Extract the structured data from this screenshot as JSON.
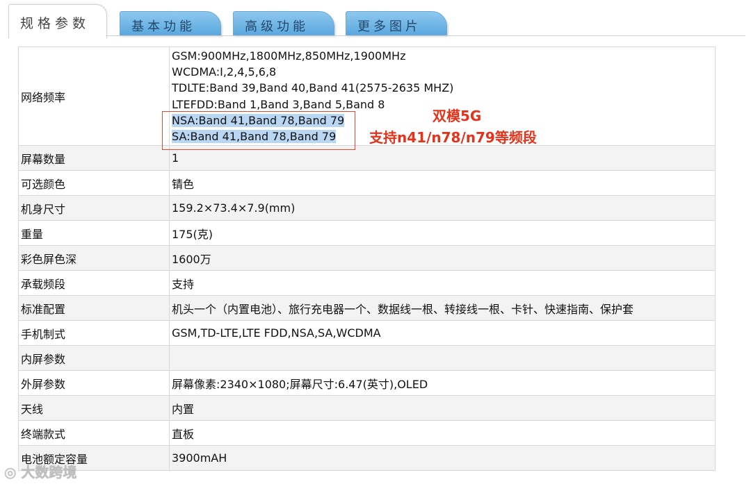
{
  "tabs": {
    "active": "规格参数",
    "others": [
      "基本功能",
      "高级功能",
      "更多图片"
    ]
  },
  "network": {
    "label": "网络频率",
    "lines": [
      "GSM:900MHz,1800MHz,850MHz,1900MHz",
      "WCDMA:I,2,4,5,6,8",
      "TDLTE:Band 39,Band 40,Band 41(2575-2635 MHZ)",
      "LTEFDD:Band 1,Band 3,Band 5,Band 8",
      "NSA:Band 41,Band 78,Band 79",
      "SA:Band 41,Band 78,Band 79"
    ]
  },
  "annotation": {
    "line1": "双模5G",
    "line2": "支持n41/n78/n79等频段"
  },
  "rows": [
    {
      "label": "屏幕数量",
      "value": "1"
    },
    {
      "label": "可选颜色",
      "value": "锖色"
    },
    {
      "label": "机身尺寸",
      "value": "159.2×73.4×7.9(mm)"
    },
    {
      "label": "重量",
      "value": "175(克)"
    },
    {
      "label": "彩色屏色深",
      "value": "1600万"
    },
    {
      "label": "承载频段",
      "value": "支持"
    },
    {
      "label": "标准配置",
      "value": "机头一个（内置电池）、旅行充电器一个、数据线一根、转接线一根、卡针、快速指南、保护套"
    },
    {
      "label": "手机制式",
      "value": "GSM,TD-LTE,LTE FDD,NSA,SA,WCDMA"
    },
    {
      "label": "内屏参数",
      "value": ""
    },
    {
      "label": "外屏参数",
      "value": "屏幕像素:2340×1080;屏幕尺寸:6.47(英寸),OLED"
    },
    {
      "label": "天线",
      "value": "内置"
    },
    {
      "label": "终端款式",
      "value": "直板"
    },
    {
      "label": "电池额定容量",
      "value": "3900mAH"
    }
  ],
  "watermark": "大数跨境",
  "colors": {
    "annotation": "#e5331b",
    "highlight": "#b9d6f3",
    "tab": "#5aa8de"
  }
}
